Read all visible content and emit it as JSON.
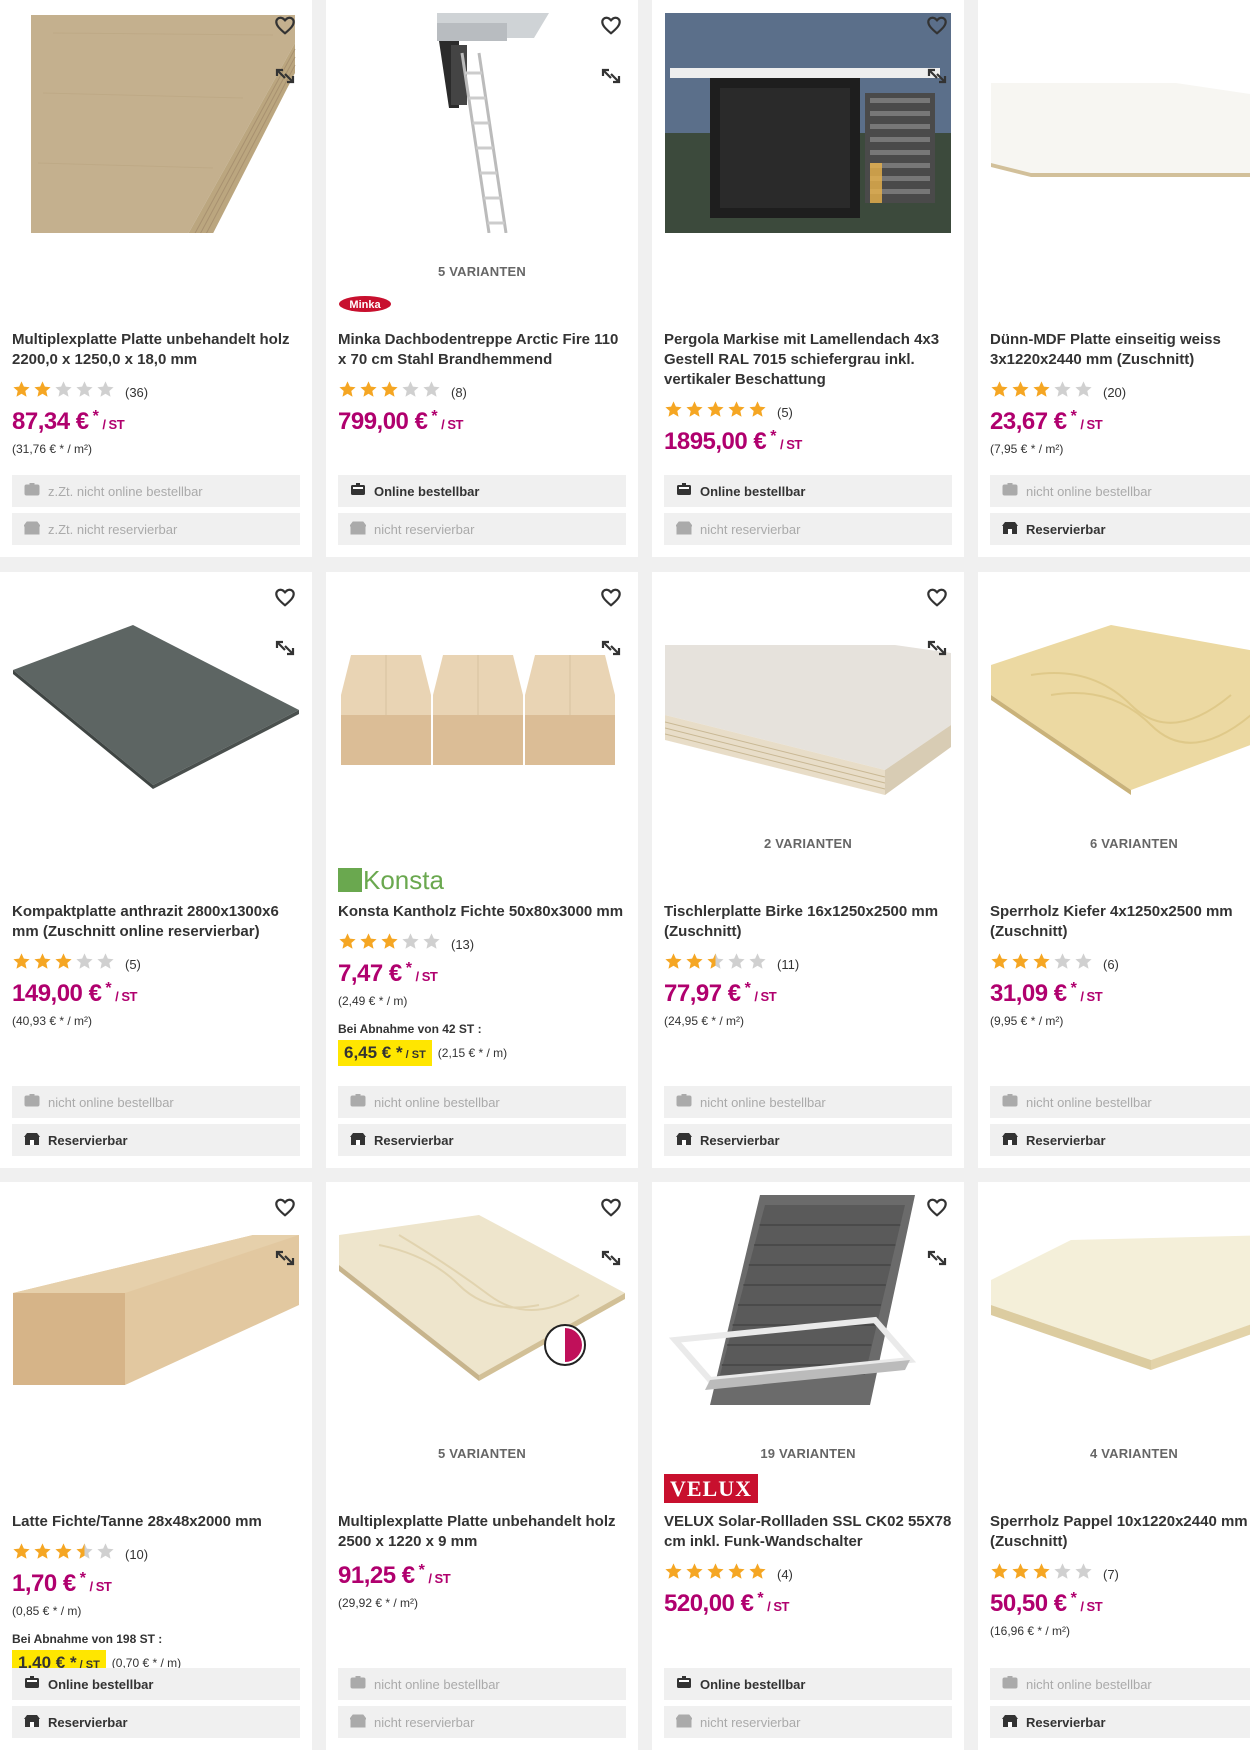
{
  "products": [
    {
      "title": "Multiplexplatte Platte unbehandelt holz 2200,0 x 1250,0 x 18,0 mm",
      "variants": "",
      "brand": "",
      "rating": 2,
      "rating_count": "(36)",
      "price": "87,34 €",
      "price_unit": "/ ST",
      "base_price": "(31,76 € * / m²)",
      "bulk_label": "",
      "bulk_price": "",
      "bulk_base": "",
      "online": "z.Zt. nicht online bestellbar",
      "online_active": false,
      "reserve": "z.Zt. nicht reservierbar",
      "reserve_active": false,
      "image": "plywood-board"
    },
    {
      "title": "Minka Dachbodentreppe Arctic Fire 110 x 70 cm Stahl Brandhemmend",
      "variants": "5 VARIANTEN",
      "brand": "Minka",
      "rating": 3,
      "rating_count": "(8)",
      "price": "799,00 €",
      "price_unit": "/ ST",
      "base_price": "",
      "bulk_label": "",
      "bulk_price": "",
      "bulk_base": "",
      "online": "Online bestellbar",
      "online_active": true,
      "reserve": "nicht reservierbar",
      "reserve_active": false,
      "image": "attic-ladder"
    },
    {
      "title": "Pergola Markise mit Lamellendach 4x3 Gestell RAL 7015 schiefergrau inkl. vertikaler Beschattung",
      "variants": "",
      "brand": "",
      "rating": 5,
      "rating_count": "(5)",
      "price": "1895,00 €",
      "price_unit": "/ ST",
      "base_price": "",
      "bulk_label": "",
      "bulk_price": "",
      "bulk_base": "",
      "online": "Online bestellbar",
      "online_active": true,
      "reserve": "nicht reservierbar",
      "reserve_active": false,
      "image": "pergola"
    },
    {
      "title": "Dünn-MDF Platte einseitig weiss 3x1220x2440 mm (Zuschnitt)",
      "variants": "",
      "brand": "",
      "rating": 3,
      "rating_count": "(20)",
      "price": "23,67 €",
      "price_unit": "/ ST",
      "base_price": "(7,95 € * / m²)",
      "bulk_label": "",
      "bulk_price": "",
      "bulk_base": "",
      "online": "nicht online bestellbar",
      "online_active": false,
      "reserve": "Reservierbar",
      "reserve_active": true,
      "image": "white-mdf"
    },
    {
      "title": "Kompaktplatte anthrazit 2800x1300x6 mm (Zuschnitt online reservierbar)",
      "variants": "",
      "brand": "",
      "rating": 3,
      "rating_count": "(5)",
      "price": "149,00 €",
      "price_unit": "/ ST",
      "base_price": "(40,93 € * / m²)",
      "bulk_label": "",
      "bulk_price": "",
      "bulk_base": "",
      "online": "nicht online bestellbar",
      "online_active": false,
      "reserve": "Reservierbar",
      "reserve_active": true,
      "image": "anthracite-board"
    },
    {
      "title": "Konsta Kantholz Fichte 50x80x3000 mm",
      "variants": "",
      "brand": "Konsta",
      "rating": 3,
      "rating_count": "(13)",
      "price": "7,47 €",
      "price_unit": "/ ST",
      "base_price": "(2,49 € * / m)",
      "bulk_label": "Bei Abnahme von 42 ST :",
      "bulk_price": "6,45 €",
      "bulk_base": "(2,15 € * / m)",
      "online": "nicht online bestellbar",
      "online_active": false,
      "reserve": "Reservierbar",
      "reserve_active": true,
      "image": "timber-beams"
    },
    {
      "title": "Tischlerplatte Birke 16x1250x2500 mm (Zuschnitt)",
      "variants": "2 VARIANTEN",
      "brand": "",
      "rating": 2.5,
      "rating_count": "(11)",
      "price": "77,97 €",
      "price_unit": "/ ST",
      "base_price": "(24,95 € * / m²)",
      "bulk_label": "",
      "bulk_price": "",
      "bulk_base": "",
      "online": "nicht online bestellbar",
      "online_active": false,
      "reserve": "Reservierbar",
      "reserve_active": true,
      "image": "birch-board"
    },
    {
      "title": "Sperrholz Kiefer 4x1250x2500 mm (Zuschnitt)",
      "variants": "6 VARIANTEN",
      "brand": "",
      "rating": 3,
      "rating_count": "(6)",
      "price": "31,09 €",
      "price_unit": "/ ST",
      "base_price": "(9,95 € * / m²)",
      "bulk_label": "",
      "bulk_price": "",
      "bulk_base": "",
      "online": "nicht online bestellbar",
      "online_active": false,
      "reserve": "Reservierbar",
      "reserve_active": true,
      "image": "pine-plywood"
    },
    {
      "title": "Latte Fichte/Tanne 28x48x2000 mm",
      "variants": "",
      "brand": "",
      "rating": 3.5,
      "rating_count": "(10)",
      "price": "1,70 €",
      "price_unit": "/ ST",
      "base_price": "(0,85 € * / m)",
      "bulk_label": "Bei Abnahme von 198 ST :",
      "bulk_price": "1,40 €",
      "bulk_base": "(0,70 € * / m)",
      "online": "Online bestellbar",
      "online_active": true,
      "reserve": "Reservierbar",
      "reserve_active": true,
      "image": "lath"
    },
    {
      "title": "Multiplexplatte Platte unbehandelt holz 2500 x 1220 x 9 mm",
      "variants": "5 VARIANTEN",
      "brand": "",
      "rating": 0,
      "rating_count": "",
      "price": "91,25 €",
      "price_unit": "/ ST",
      "base_price": "(29,92 € * / m²)",
      "bulk_label": "",
      "bulk_price": "",
      "bulk_base": "",
      "online": "nicht online bestellbar",
      "online_active": false,
      "reserve": "nicht reservierbar",
      "reserve_active": false,
      "image": "multiplex-thin"
    },
    {
      "title": "VELUX Solar-Rollladen SSL CK02 55X78 cm inkl. Funk-Wandschalter",
      "variants": "19 VARIANTEN",
      "brand": "VELUX",
      "rating": 5,
      "rating_count": "(4)",
      "price": "520,00 €",
      "price_unit": "/ ST",
      "base_price": "",
      "bulk_label": "",
      "bulk_price": "",
      "bulk_base": "",
      "online": "Online bestellbar",
      "online_active": true,
      "reserve": "nicht reservierbar",
      "reserve_active": false,
      "image": "roof-window"
    },
    {
      "title": "Sperrholz Pappel 10x1220x2440 mm (Zuschnitt)",
      "variants": "4 VARIANTEN",
      "brand": "",
      "rating": 3,
      "rating_count": "(7)",
      "price": "50,50 €",
      "price_unit": "/ ST",
      "base_price": "(16,96 € * / m²)",
      "bulk_label": "",
      "bulk_price": "",
      "bulk_base": "",
      "online": "nicht online bestellbar",
      "online_active": false,
      "reserve": "Reservierbar",
      "reserve_active": true,
      "image": "poplar-plywood"
    }
  ],
  "colors": {
    "price": "#b0006e",
    "star": "#f5a623",
    "star_empty": "#d0d0d0",
    "highlight": "#ffe600",
    "velux": "#c8102e"
  },
  "icons": {
    "favorite": "heart-outline-icon",
    "compare": "compare-arrows-icon",
    "online": "truck-icon",
    "reserve": "store-icon"
  }
}
